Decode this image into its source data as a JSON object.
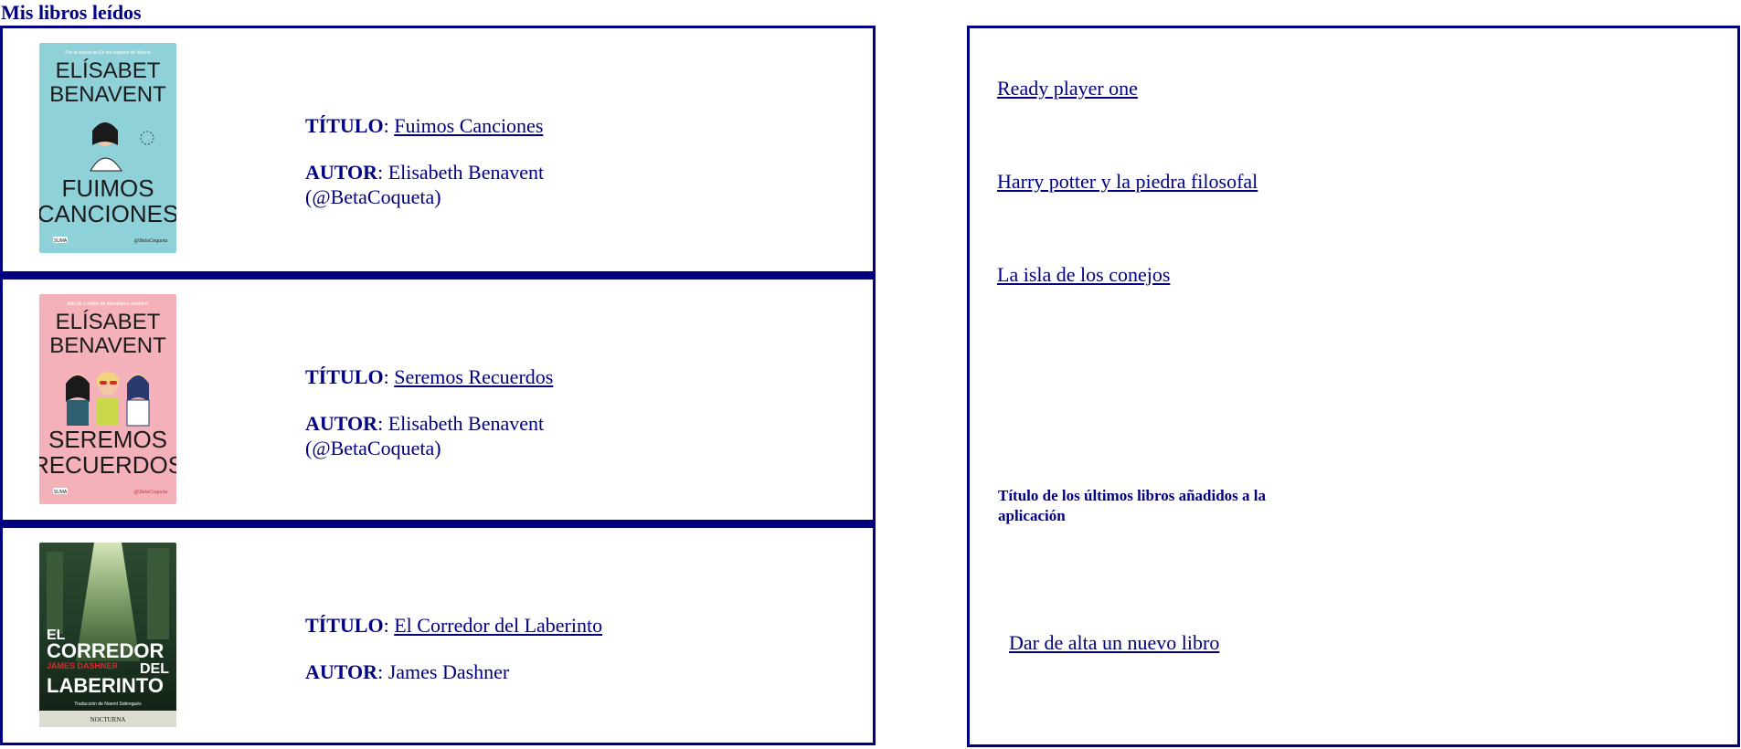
{
  "page": {
    "title": "Mis libros leídos"
  },
  "books": [
    {
      "title_label": "TÍTULO",
      "title": "Fuimos Canciones",
      "author_label": "AUTOR",
      "author_line1": "Elisabeth Benavent",
      "author_line2": "(@BetaCoqueta)",
      "cover": {
        "banner": "Por la autora de En los zapatos de Valeria",
        "author": [
          "ELÍSABET",
          "BENAVENT"
        ],
        "title": [
          "FUIMOS",
          "CANCIONES"
        ],
        "publisher": "SUMA",
        "signature": "@BetaCoqueta",
        "background": "#8fd1d8",
        "ink": "#1a1a1a"
      }
    },
    {
      "title_label": "TÍTULO",
      "title": "Seremos Recuerdos",
      "author_label": "AUTOR",
      "author_line1": "Elisabeth Benavent",
      "author_line2": "(@BetaCoqueta)",
      "cover": {
        "banner": "Más de 1 millón de ejemplares vendidos",
        "author": [
          "ELÍSABET",
          "BENAVENT"
        ],
        "title": [
          "SEREMOS",
          "RECUERDOS"
        ],
        "publisher": "SUMA",
        "signature": "@BetaCoqueta",
        "background": "#f4b1ba",
        "ink": "#1a1a1a"
      }
    },
    {
      "title_label": "TÍTULO",
      "title": "El Corredor del Laberinto",
      "author_label": "AUTOR",
      "author_line1": "James Dashner",
      "author_line2": "",
      "cover": {
        "title_lines": [
          "EL",
          "CORREDOR",
          "DEL",
          "LABERINTO"
        ],
        "author_small": "JAMES DASHNER",
        "translator": "Traducción de Noemí Sobregués",
        "publisher": "NOCTURNA",
        "background": "#1f3a26",
        "ink": "#ffffff"
      }
    }
  ],
  "sidebar": {
    "recent_books": [
      "Ready player one",
      "Harry potter y la piedra filosofal",
      "La isla de los conejos"
    ],
    "caption": "Título de los últimos libros añadidos a la aplicación",
    "add_book_label": "Dar de alta un nuevo libro"
  },
  "colors": {
    "accent": "#000080",
    "background": "#ffffff"
  }
}
